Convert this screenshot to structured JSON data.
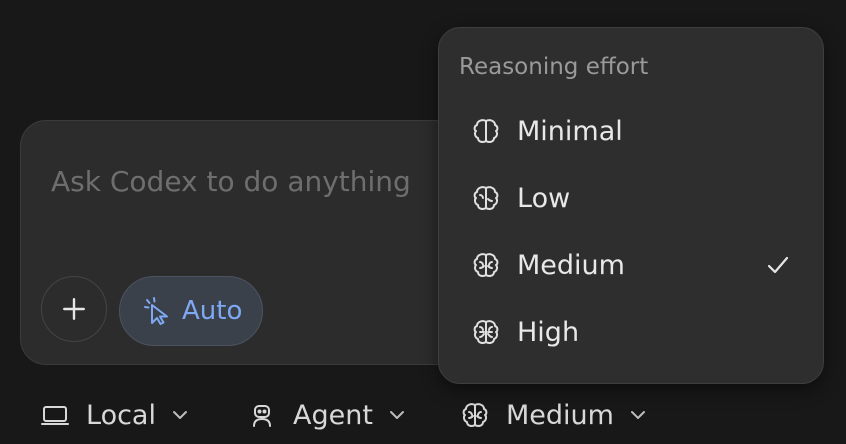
{
  "composer": {
    "placeholder": "Ask Codex to do anything",
    "add_icon": "plus-icon",
    "mode_chip": {
      "label": "Auto",
      "icon": "cursor-pointer-icon",
      "color": "#7ea8f2"
    }
  },
  "bottom_bar": {
    "environment": {
      "label": "Local",
      "icon": "laptop-icon"
    },
    "agent": {
      "label": "Agent",
      "icon": "robot-icon"
    },
    "reasoning": {
      "label": "Medium",
      "icon": "brain-icon"
    }
  },
  "reasoning_menu": {
    "title": "Reasoning effort",
    "selected": "Medium",
    "options": [
      {
        "label": "Minimal",
        "icon": "brain-outline-icon"
      },
      {
        "label": "Low",
        "icon": "brain-icon"
      },
      {
        "label": "Medium",
        "icon": "brain-icon",
        "checked": true
      },
      {
        "label": "High",
        "icon": "brain-icon"
      }
    ]
  }
}
